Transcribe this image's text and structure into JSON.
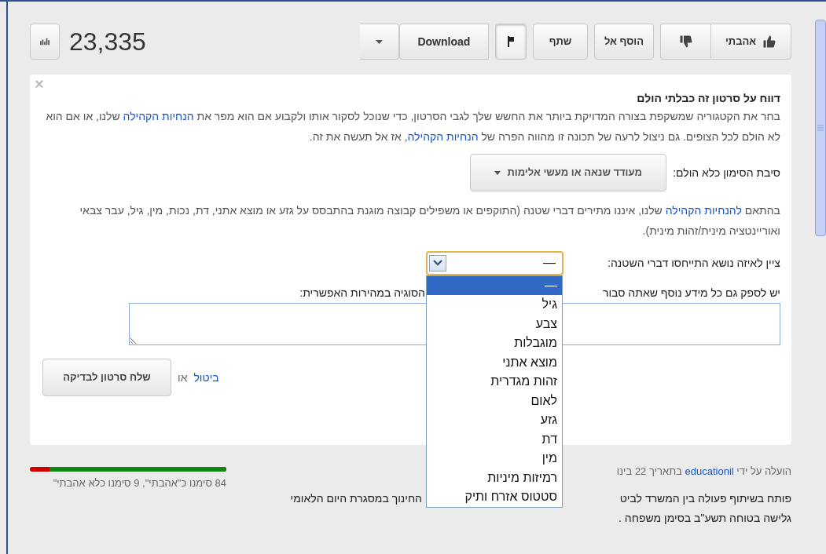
{
  "stats": {
    "views": "23,335"
  },
  "actions": [
    {
      "kind": "like",
      "label": "אהבתי"
    },
    {
      "kind": "dislike"
    },
    {
      "kind": "text",
      "label": "הוסף אל"
    },
    {
      "kind": "text",
      "label": "שתף"
    },
    {
      "kind": "flag",
      "pressed": true
    },
    {
      "kind": "download",
      "label": "Download"
    }
  ],
  "report_panel": {
    "close": "×",
    "title": "דווח על סרטון זה כבלתי הולם",
    "intro": [
      {
        "text": "בחר את הקטגוריה שמשקפת בצורה המדויקת ביותר את החשש שלך לגבי הסרטון, כדי שנוכל לסקור אותו ולקבוע אם הוא מפר את ",
        "link": false
      },
      {
        "text": "הנחיות הקהילה",
        "link": true
      },
      {
        "text": " שלנו, או אם הוא לא הולם לכל הצופים. גם ניצול לרעה של תכונה זו מהווה הפרה של ",
        "link": false
      },
      {
        "text": "הנחיות הקהילה",
        "link": true
      },
      {
        "text": ", אז אל תעשה את זה.",
        "link": false
      }
    ],
    "reason": {
      "label": "סיבת הסימון כלא הולם:",
      "value": "מעודד שנאה או מעשי אלימות"
    },
    "policy": [
      {
        "text": "בהתאם ",
        "link": false
      },
      {
        "text": "להנחיות הקהילה",
        "link": true
      },
      {
        "text": " שלנו, איננו מתירים דברי שטנה (התוקפים או משפילים קבוצה מוגנת בהתבסס על גזע או מוצא אתני, דת, נכות, מין, גיל, עבר צבאי ואוריינטציה מינית/זהות מינית).",
        "link": false
      }
    ],
    "topic": {
      "label": "ציין לאיזה נושא התייחסו דברי השטנה:",
      "value": "—",
      "open": true,
      "options": [
        {
          "label": "—",
          "selected": true
        },
        {
          "label": "גיל",
          "selected": false
        },
        {
          "label": "צבע",
          "selected": false
        },
        {
          "label": "מוגבלות",
          "selected": false
        },
        {
          "label": "מוצא אתני",
          "selected": false
        },
        {
          "label": "זהות מגדרית",
          "selected": false
        },
        {
          "label": "לאום",
          "selected": false
        },
        {
          "label": "גזע",
          "selected": false
        },
        {
          "label": "דת",
          "selected": false
        },
        {
          "label": "מין",
          "selected": false
        },
        {
          "label": "רמיזות מיניות",
          "selected": false
        },
        {
          "label": "סטטוס אזרח ותיק",
          "selected": false
        }
      ]
    },
    "details_label": [
      "יש לספק גם כל מידע נוסף שאתה סבור",
      "הסוגיה במהירות האפשרית:"
    ],
    "submit": "שלח סרטון לבדיקה",
    "or": "או",
    "cancel": "ביטול"
  },
  "rating": {
    "level": 0.9,
    "text": "84 סימנו כ\"אהבתי\", 9 סימנו כלא אהבתי\""
  },
  "upload": {
    "prefix": "הועלה על ידי",
    "user": "educationil",
    "suffix": "בתאריך 22 בינו"
  },
  "description": [
    [
      "פותח בשיתוף פעולה בין המשרד לביט",
      "החינוך במסגרת היום הלאומי"
    ],
    [
      "גלישה בטוחה תשע\"ב בסימן משפחה ."
    ]
  ]
}
